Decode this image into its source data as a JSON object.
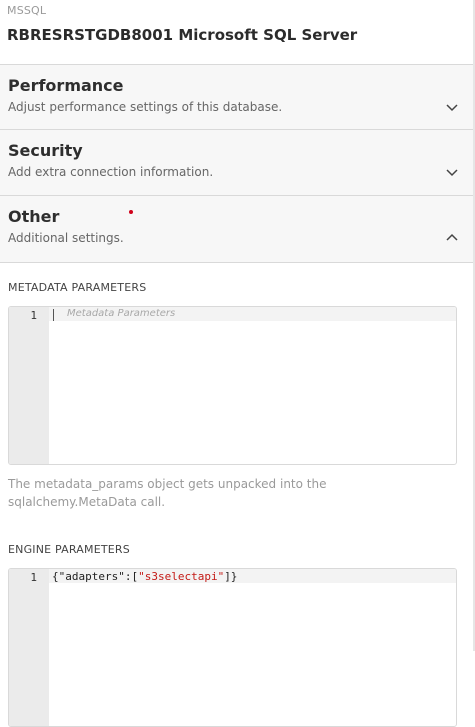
{
  "header": {
    "db_type": "MSSQL",
    "db_name": "RBRESRSTGDB8001 Microsoft SQL Server"
  },
  "panels": [
    {
      "title": "Performance",
      "description": "Adjust performance settings of this database.",
      "expanded": false,
      "chevron_icon": "chevron-down-icon"
    },
    {
      "title": "Security",
      "description": "Add extra connection information.",
      "expanded": false,
      "chevron_icon": "chevron-down-icon"
    },
    {
      "title": "Other",
      "description": "Additional settings.",
      "expanded": true,
      "chevron_icon": "chevron-up-icon",
      "indicator_color": "#d0021b"
    }
  ],
  "metadata": {
    "label": "METADATA PARAMETERS",
    "line_number": "1",
    "placeholder": "Metadata Parameters",
    "help": "The metadata_params object gets unpacked into the sqlalchemy.MetaData call."
  },
  "engine": {
    "label": "ENGINE PARAMETERS",
    "line_number": "1",
    "code_prefix": "{\"adapters\":[",
    "code_string": "\"s3selectapi\"",
    "code_suffix": "]}"
  },
  "colors": {
    "string_literal": "#c41a16",
    "indicator": "#d0021b"
  }
}
